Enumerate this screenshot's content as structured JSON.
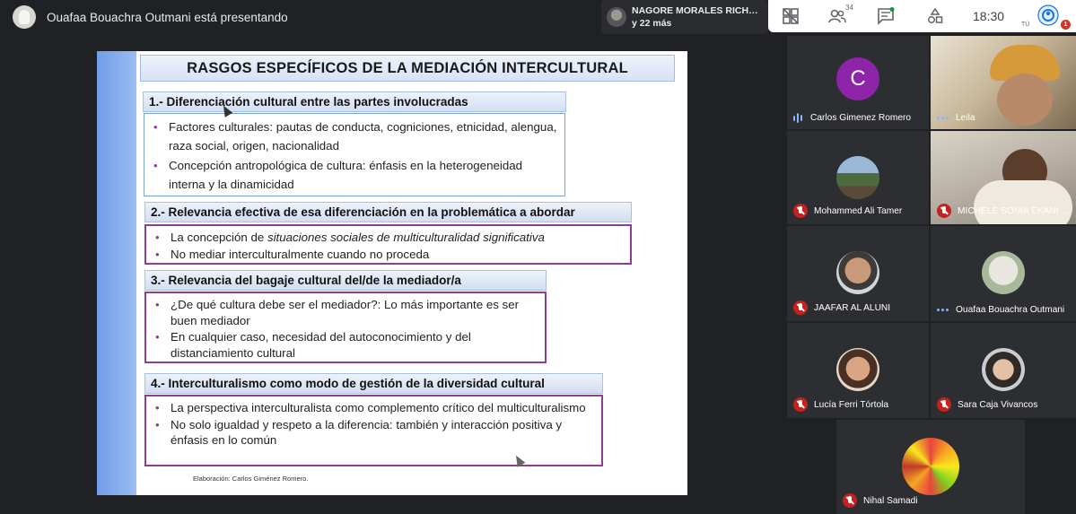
{
  "presenter": {
    "text": "Ouafaa Bouachra Outmani está presentando"
  },
  "participants_chip": {
    "line1": "NAGORE MORALES RICH…",
    "line2": "y 22 más"
  },
  "toolbar": {
    "people_count": "34",
    "time": "18:30",
    "you_label": "TÚ",
    "badge": "1"
  },
  "slide": {
    "title": "RASGOS ESPECÍFICOS DE LA MEDIACIÓN INTERCULTURAL",
    "sections": [
      {
        "heading": "1.- Diferenciación cultural entre las partes involucradas",
        "items": [
          "Factores culturales: pautas de conducta, cogniciones, etnicidad, alengua, raza social, origen, nacionalidad",
          "Concepción antropológica de cultura: énfasis en la heterogeneidad interna y la dinamicidad"
        ]
      },
      {
        "heading": "2.-  Relevancia efectiva de esa diferenciación en la problemática a abordar",
        "items_rich": [
          {
            "prefix": "La concepción de ",
            "emph": "situaciones sociales de multiculturalidad significativa"
          }
        ],
        "items": [
          "No mediar interculturalmente cuando no proceda"
        ]
      },
      {
        "heading": "3.-  Relevancia del bagaje cultural del/de la mediador/a",
        "items": [
          "¿De qué cultura debe ser el mediador?: Lo más importante es ser buen mediador",
          "En cualquier caso, necesidad del autoconocimiento y del distanciamiento cultural"
        ]
      },
      {
        "heading": "4.-  Interculturalismo como modo de gestión de la diversidad cultural",
        "items": [
          "La perspectiva interculturalista como complemento crítico del multiculturalismo",
          "No solo igualdad y respeto a la diferencia: también y  interacción positiva y énfasis en lo común"
        ]
      }
    ],
    "credit": "Elaboración: Carlos Giménez Romero."
  },
  "tiles": [
    {
      "name": "Carlos Gimenez Romero",
      "status": "speaking",
      "initial": "C",
      "color": "#8e24aa"
    },
    {
      "name": "Leila",
      "status": "dots"
    },
    {
      "name": "Mohammed Ali Tamer",
      "status": "muted"
    },
    {
      "name": "MICHELE SONIA EKANI …",
      "status": "muted"
    },
    {
      "name": "JAAFAR AL ALUNI",
      "status": "muted"
    },
    {
      "name": "Ouafaa Bouachra Outmani",
      "status": "dots"
    },
    {
      "name": "Lucía Ferri Tórtola",
      "status": "muted"
    },
    {
      "name": "Sara Caja Vivancos",
      "status": "muted"
    },
    {
      "name": "Nihal Samadi",
      "status": "muted"
    }
  ],
  "icons": [
    "presenter-avatar-icon",
    "activities-icon",
    "people-icon",
    "chat-icon",
    "shapes-icon",
    "user-account-icon",
    "mic-off-icon",
    "speaking-indicator-icon"
  ]
}
